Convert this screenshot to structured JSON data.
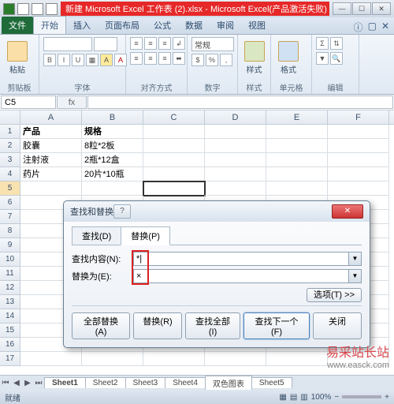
{
  "title": "新建 Microsoft Excel 工作表 (2).xlsx - Microsoft Excel(产品激活失败)",
  "tabs": {
    "file": "文件",
    "home": "开始",
    "insert": "插入",
    "layout": "页面布局",
    "formula": "公式",
    "data": "数据",
    "review": "审阅",
    "view": "视图"
  },
  "ribbon": {
    "clipboard": {
      "paste": "粘贴",
      "label": "剪贴板"
    },
    "font": {
      "label": "字体",
      "bold": "B",
      "italic": "I",
      "underline": "U"
    },
    "align": {
      "label": "对齐方式",
      "general": "常规"
    },
    "number": {
      "label": "数字"
    },
    "styles": {
      "label": "样式",
      "btn": "样式"
    },
    "cells": {
      "label": "单元格",
      "btn": "格式"
    },
    "edit": {
      "label": "编辑"
    }
  },
  "namebox": "C5",
  "cols": [
    "A",
    "B",
    "C",
    "D",
    "E",
    "F"
  ],
  "rows": [
    {
      "n": 1,
      "A": "产品",
      "B": "规格"
    },
    {
      "n": 2,
      "A": "胶囊",
      "B": "8粒*2板"
    },
    {
      "n": 3,
      "A": "注射液",
      "B": "2瓶*12盒"
    },
    {
      "n": 4,
      "A": "药片",
      "B": "20片*10瓶"
    },
    {
      "n": 5
    },
    {
      "n": 6
    },
    {
      "n": 7
    },
    {
      "n": 8
    },
    {
      "n": 9
    },
    {
      "n": 10
    },
    {
      "n": 11
    },
    {
      "n": 12
    },
    {
      "n": 13
    },
    {
      "n": 14
    },
    {
      "n": 15
    },
    {
      "n": 16
    },
    {
      "n": 17
    }
  ],
  "sheets": [
    "Sheet1",
    "Sheet2",
    "Sheet3",
    "Sheet4",
    "双色图表",
    "Sheet5"
  ],
  "status": {
    "ready": "就绪",
    "zoom": "100%"
  },
  "dialog": {
    "title": "查找和替换",
    "tab_find": "查找(D)",
    "tab_replace": "替换(P)",
    "find_label": "查找内容(N):",
    "find_value": "*|",
    "replace_label": "替换为(E):",
    "replace_value": "×",
    "options": "选项(T) >>",
    "btn_replace_all": "全部替换(A)",
    "btn_replace": "替换(R)",
    "btn_find_all": "查找全部(I)",
    "btn_find_next": "查找下一个(F)",
    "btn_close": "关闭"
  },
  "watermark": {
    "text": "易采站长站",
    "url": "www.easck.com"
  }
}
